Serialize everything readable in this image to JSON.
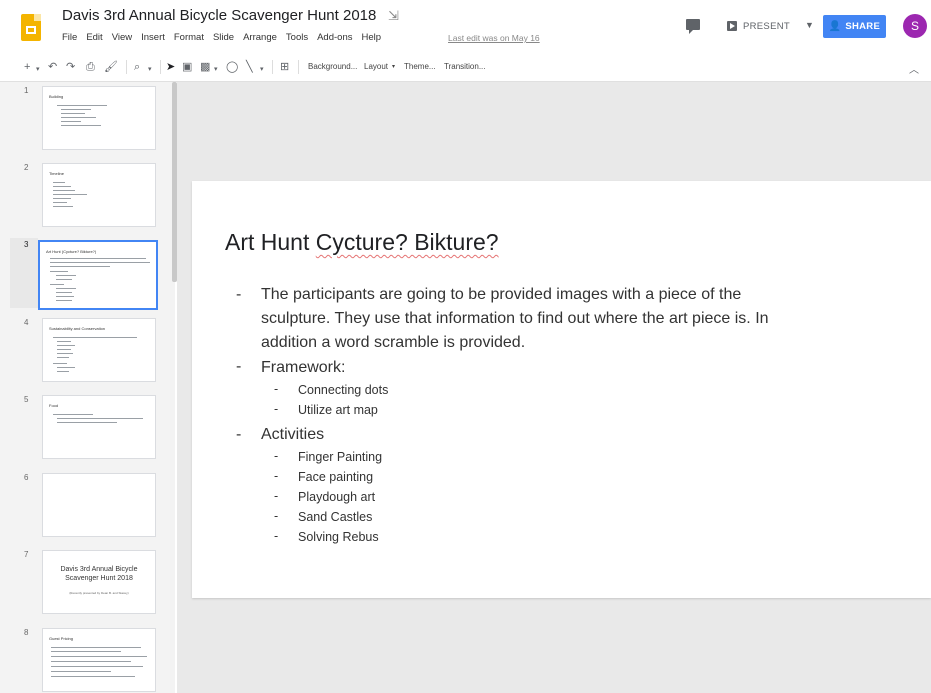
{
  "header": {
    "doc_title": "Davis 3rd Annual Bicycle Scavenger Hunt 2018",
    "menu": [
      "File",
      "Edit",
      "View",
      "Insert",
      "Format",
      "Slide",
      "Arrange",
      "Tools",
      "Add-ons",
      "Help"
    ],
    "last_edit": "Last edit was on May 16",
    "present_label": "PRESENT",
    "share_label": "SHARE",
    "avatar_letter": "S"
  },
  "toolbar": {
    "background_label": "Background...",
    "layout_label": "Layout",
    "theme_label": "Theme...",
    "transition_label": "Transition..."
  },
  "filmstrip": {
    "slides": [
      {
        "number": "1",
        "title": "Building"
      },
      {
        "number": "2",
        "title": "Timeline"
      },
      {
        "number": "3",
        "title": "Art Hunt (Cycture? Bikture?)"
      },
      {
        "number": "4",
        "title": "Sustainability and Conservation"
      },
      {
        "number": "5",
        "title": "Food"
      },
      {
        "number": "6",
        "title": ""
      },
      {
        "number": "7",
        "title": "Davis 3rd Annual Bicycle Scavenger Hunt 2018",
        "subtitle": "(Recently presented by Dean B. and Stacey)"
      },
      {
        "number": "8",
        "title": "Guest Pricing"
      }
    ]
  },
  "slide": {
    "title_part1": "Art Hunt ",
    "title_part2": "Cycture? Bikture?",
    "bullets": [
      {
        "dash": "-",
        "lines": [
          "The participants are going to be provided images with a piece of the",
          "sculpture. They use that information to find out where the art piece is. In",
          "addition a word scramble is provided."
        ]
      },
      {
        "dash": "-",
        "lines": [
          "Framework:"
        ],
        "subs": [
          "Connecting dots",
          "Utilize art map"
        ]
      },
      {
        "dash": "-",
        "lines": [
          "Activities"
        ],
        "subs": [
          "Finger Painting",
          "Face painting",
          "Playdough art",
          "Sand Castles",
          "Solving Rebus"
        ]
      }
    ]
  }
}
